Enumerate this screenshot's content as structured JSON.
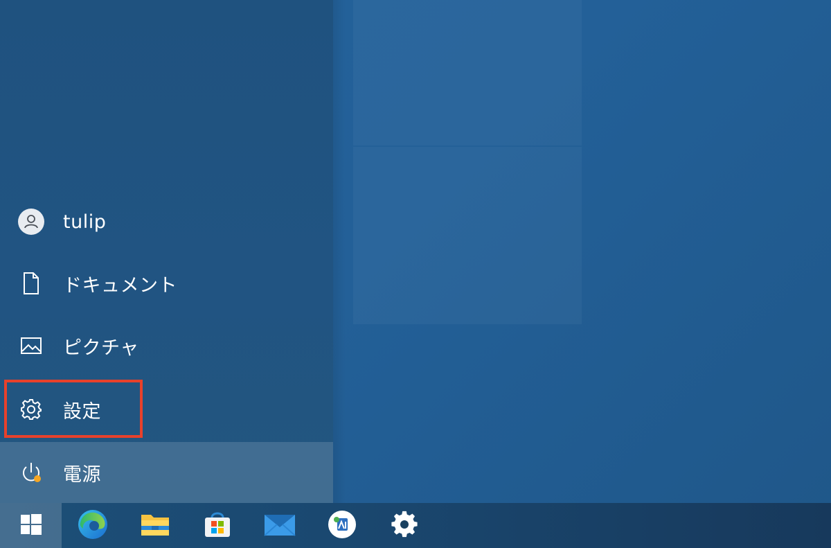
{
  "start_menu": {
    "items": [
      {
        "label": "tulip",
        "icon": "user-avatar-icon"
      },
      {
        "label": "ドキュメント",
        "icon": "document-icon"
      },
      {
        "label": "ピクチャ",
        "icon": "picture-icon"
      },
      {
        "label": "設定",
        "icon": "gear-icon"
      },
      {
        "label": "電源",
        "icon": "power-icon"
      }
    ],
    "highlight_color": "#e8412b"
  },
  "taskbar": {
    "items": [
      {
        "icon": "windows-start-icon"
      },
      {
        "icon": "edge-browser-icon"
      },
      {
        "icon": "file-explorer-icon"
      },
      {
        "icon": "microsoft-store-icon"
      },
      {
        "icon": "mail-icon"
      },
      {
        "icon": "app-icon"
      },
      {
        "icon": "settings-gear-icon"
      }
    ]
  },
  "colors": {
    "desktop_blue": "#23629b",
    "panel_blue": "#215482",
    "taskbar_blue": "#1a4870",
    "power_badge": "#f5a623"
  }
}
